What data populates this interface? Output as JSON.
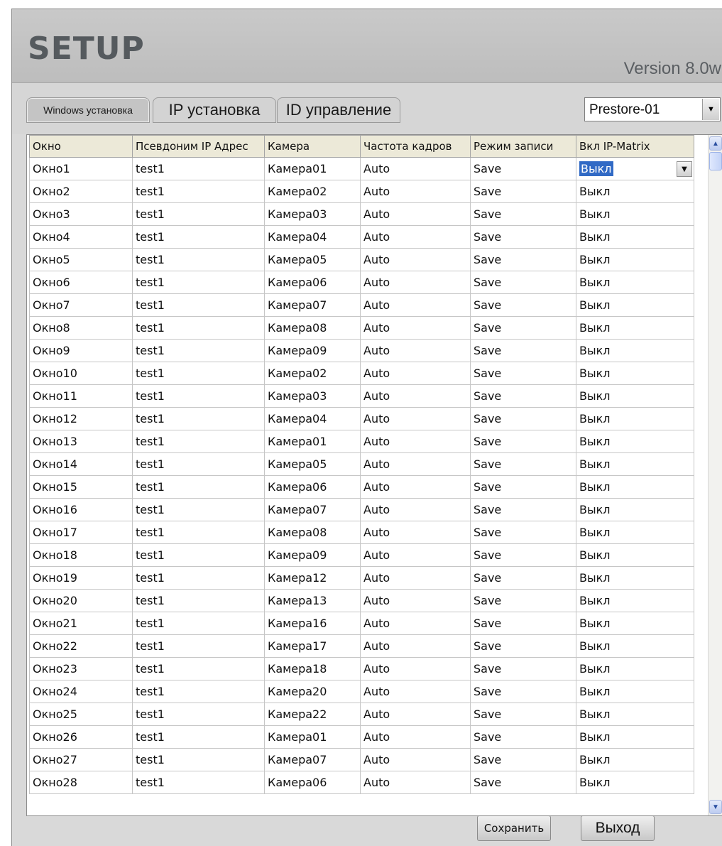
{
  "header": {
    "title": "SETUP",
    "version": "Version 8.0w"
  },
  "tabs": [
    {
      "label": "Windows установка",
      "active": true
    },
    {
      "label": "IP установка",
      "active": false
    },
    {
      "label": "ID управление",
      "active": false
    }
  ],
  "profile_select": {
    "value": "Prestore-01"
  },
  "table": {
    "columns": [
      "Окно",
      "Псевдоним IP Адрес",
      "Камера",
      "Частота кадров",
      "Режим записи",
      "Вкл IP-Matrix"
    ],
    "rows": [
      [
        "Окно1",
        "test1",
        "Камера01",
        "Auto",
        "Save",
        "Выкл"
      ],
      [
        "Окно2",
        "test1",
        "Камера02",
        "Auto",
        "Save",
        "Выкл"
      ],
      [
        "Окно3",
        "test1",
        "Камера03",
        "Auto",
        "Save",
        "Выкл"
      ],
      [
        "Окно4",
        "test1",
        "Камера04",
        "Auto",
        "Save",
        "Выкл"
      ],
      [
        "Окно5",
        "test1",
        "Камера05",
        "Auto",
        "Save",
        "Выкл"
      ],
      [
        "Окно6",
        "test1",
        "Камера06",
        "Auto",
        "Save",
        "Выкл"
      ],
      [
        "Окно7",
        "test1",
        "Камера07",
        "Auto",
        "Save",
        "Выкл"
      ],
      [
        "Окно8",
        "test1",
        "Камера08",
        "Auto",
        "Save",
        "Выкл"
      ],
      [
        "Окно9",
        "test1",
        "Камера09",
        "Auto",
        "Save",
        "Выкл"
      ],
      [
        "Окно10",
        "test1",
        "Камера02",
        "Auto",
        "Save",
        "Выкл"
      ],
      [
        "Окно11",
        "test1",
        "Камера03",
        "Auto",
        "Save",
        "Выкл"
      ],
      [
        "Окно12",
        "test1",
        "Камера04",
        "Auto",
        "Save",
        "Выкл"
      ],
      [
        "Окно13",
        "test1",
        "Камера01",
        "Auto",
        "Save",
        "Выкл"
      ],
      [
        "Окно14",
        "test1",
        "Камера05",
        "Auto",
        "Save",
        "Выкл"
      ],
      [
        "Окно15",
        "test1",
        "Камера06",
        "Auto",
        "Save",
        "Выкл"
      ],
      [
        "Окно16",
        "test1",
        "Камера07",
        "Auto",
        "Save",
        "Выкл"
      ],
      [
        "Окно17",
        "test1",
        "Камера08",
        "Auto",
        "Save",
        "Выкл"
      ],
      [
        "Окно18",
        "test1",
        "Камера09",
        "Auto",
        "Save",
        "Выкл"
      ],
      [
        "Окно19",
        "test1",
        "Камера12",
        "Auto",
        "Save",
        "Выкл"
      ],
      [
        "Окно20",
        "test1",
        "Камера13",
        "Auto",
        "Save",
        "Выкл"
      ],
      [
        "Окно21",
        "test1",
        "Камера16",
        "Auto",
        "Save",
        "Выкл"
      ],
      [
        "Окно22",
        "test1",
        "Камера17",
        "Auto",
        "Save",
        "Выкл"
      ],
      [
        "Окно23",
        "test1",
        "Камера18",
        "Auto",
        "Save",
        "Выкл"
      ],
      [
        "Окно24",
        "test1",
        "Камера20",
        "Auto",
        "Save",
        "Выкл"
      ],
      [
        "Окно25",
        "test1",
        "Камера22",
        "Auto",
        "Save",
        "Выкл"
      ],
      [
        "Окно26",
        "test1",
        "Камера01",
        "Auto",
        "Save",
        "Выкл"
      ],
      [
        "Окно27",
        "test1",
        "Камера07",
        "Auto",
        "Save",
        "Выкл"
      ],
      [
        "Окно28",
        "test1",
        "Камера06",
        "Auto",
        "Save",
        "Выкл"
      ]
    ],
    "selected_cell": {
      "row": 0,
      "column": 5
    }
  },
  "footer": {
    "save_label": "Сохранить",
    "exit_label": "Выход"
  },
  "icons": {
    "dropdown": "chevron-down-icon",
    "scroll_up": "scroll-up-icon",
    "scroll_down": "scroll-down-icon"
  },
  "colors": {
    "selection": "#316ac5",
    "header_bg": "#c4c4c4",
    "grid_header_bg": "#ece9d8"
  }
}
